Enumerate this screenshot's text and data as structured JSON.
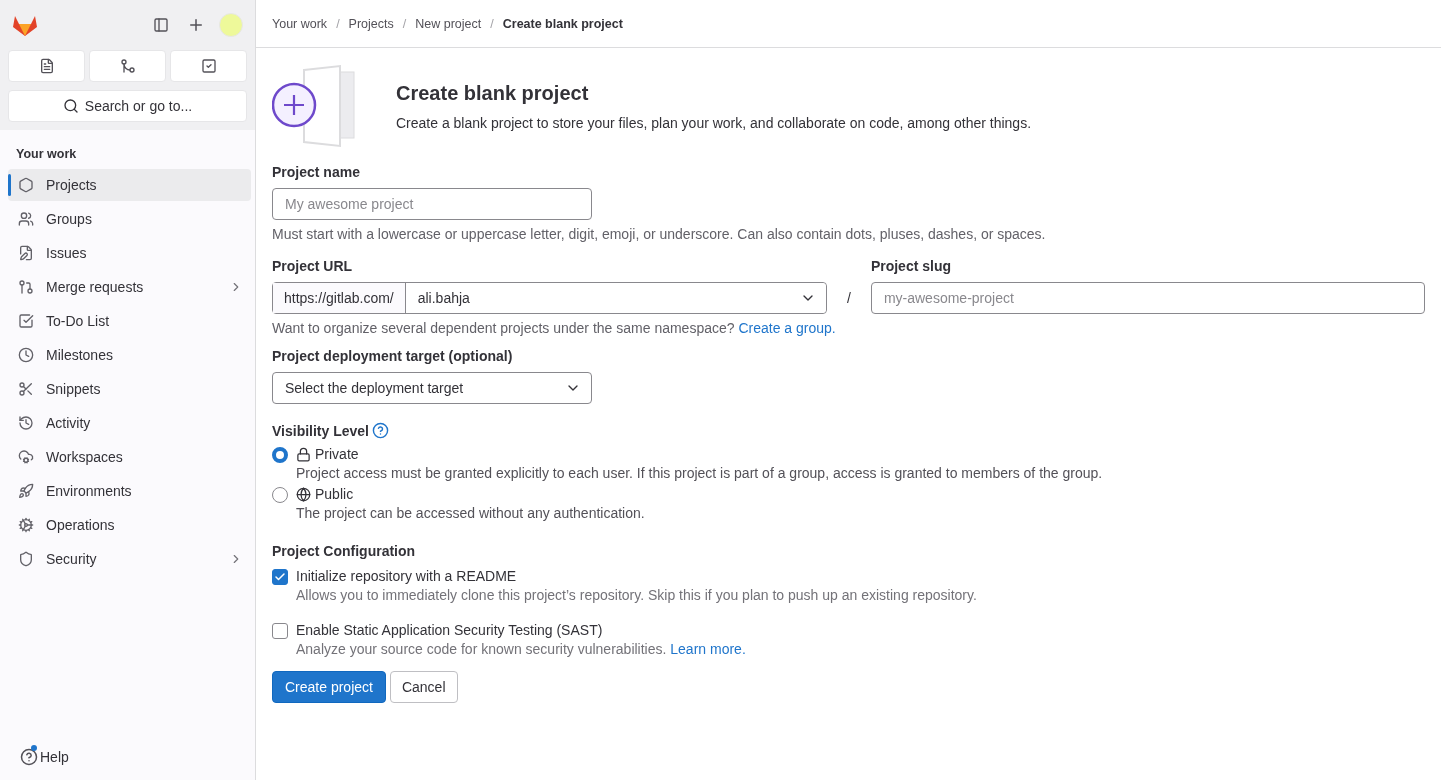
{
  "sidebar": {
    "search": {
      "placeholder": "Search or go to..."
    },
    "section_title": "Your work",
    "items": [
      {
        "label": "Projects",
        "selected": true,
        "expandable": false
      },
      {
        "label": "Groups",
        "selected": false,
        "expandable": false
      },
      {
        "label": "Issues",
        "selected": false,
        "expandable": false
      },
      {
        "label": "Merge requests",
        "selected": false,
        "expandable": true
      },
      {
        "label": "To-Do List",
        "selected": false,
        "expandable": false
      },
      {
        "label": "Milestones",
        "selected": false,
        "expandable": false
      },
      {
        "label": "Snippets",
        "selected": false,
        "expandable": false
      },
      {
        "label": "Activity",
        "selected": false,
        "expandable": false
      },
      {
        "label": "Workspaces",
        "selected": false,
        "expandable": false
      },
      {
        "label": "Environments",
        "selected": false,
        "expandable": false
      },
      {
        "label": "Operations",
        "selected": false,
        "expandable": false
      },
      {
        "label": "Security",
        "selected": false,
        "expandable": true
      }
    ],
    "help": {
      "label": "Help",
      "notification": true
    }
  },
  "breadcrumbs": {
    "separator": "/",
    "items": [
      "Your work",
      "Projects",
      "New project",
      "Create blank project"
    ]
  },
  "header": {
    "title": "Create blank project",
    "description": "Create a blank project to store your files, plan your work, and collaborate on code, among other things."
  },
  "form": {
    "project_name": {
      "label": "Project name",
      "placeholder": "My awesome project",
      "hint": "Must start with a lowercase or uppercase letter, digit, emoji, or underscore. Can also contain dots, pluses, dashes, or spaces."
    },
    "project_url": {
      "label": "Project URL",
      "prefix": "https://gitlab.com/",
      "namespace": "ali.bahja",
      "separator": "/",
      "hint": "Want to organize several dependent projects under the same namespace?",
      "link": "Create a group."
    },
    "project_slug": {
      "label": "Project slug",
      "placeholder": "my-awesome-project"
    },
    "deployment_target": {
      "label": "Project deployment target (optional)",
      "value": "Select the deployment target"
    },
    "visibility": {
      "label": "Visibility Level",
      "options": [
        {
          "label": "Private",
          "description": "Project access must be granted explicitly to each user. If this project is part of a group, access is granted to members of the group.",
          "selected": true
        },
        {
          "label": "Public",
          "description": "The project can be accessed without any authentication.",
          "selected": false
        }
      ]
    },
    "configuration": {
      "label": "Project Configuration",
      "options": [
        {
          "label": "Initialize repository with a README",
          "description": "Allows you to immediately clone this project’s repository. Skip this if you plan to push up an existing repository.",
          "checked": true
        },
        {
          "label": "Enable Static Application Security Testing (SAST)",
          "description": "Analyze your source code for known security vulnerabilities.",
          "link": "Learn more.",
          "checked": false
        }
      ]
    },
    "buttons": {
      "primary": "Create project",
      "secondary": "Cancel"
    }
  }
}
